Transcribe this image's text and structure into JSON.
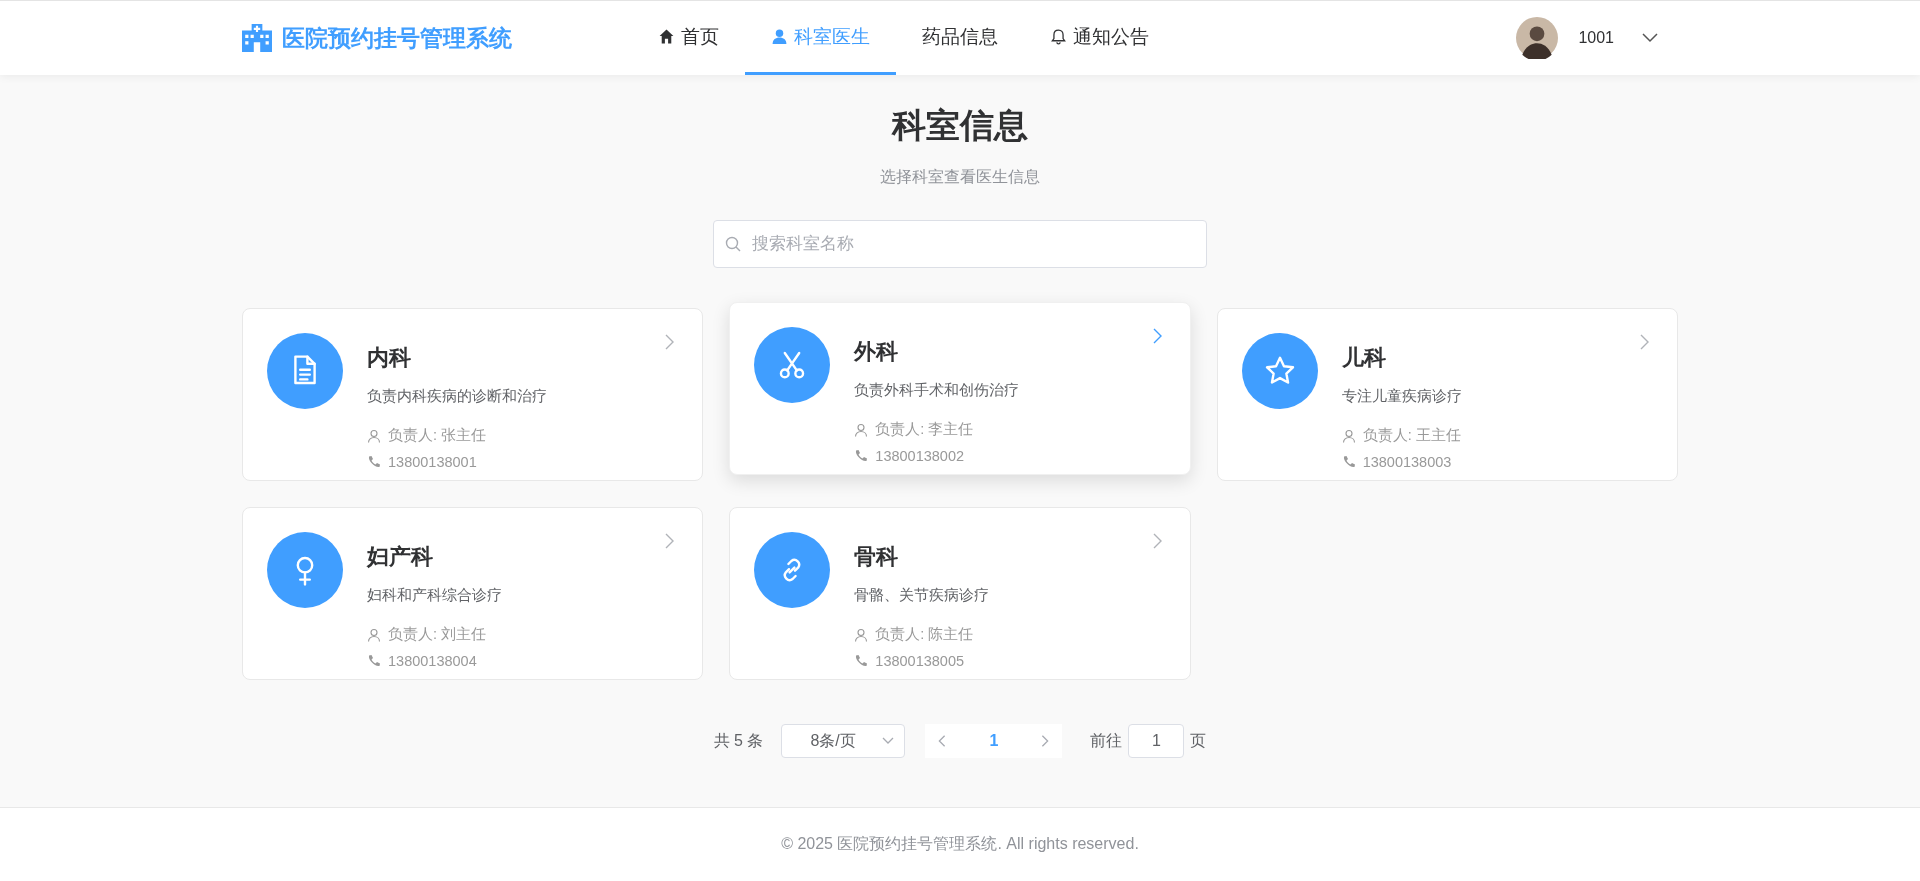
{
  "header": {
    "brand": "医院预约挂号管理系统",
    "nav": [
      {
        "label": "首页",
        "selected": false
      },
      {
        "label": "科室医生",
        "selected": true
      },
      {
        "label": "药品信息",
        "selected": false
      },
      {
        "label": "通知公告",
        "selected": false
      }
    ],
    "user": {
      "name": "1001"
    }
  },
  "page": {
    "title": "科室信息",
    "subtitle": "选择科室查看医生信息"
  },
  "search": {
    "placeholder": "搜索科室名称"
  },
  "departments": [
    {
      "name": "内科",
      "description": "负责内科疾病的诊断和治疗",
      "head": "负责人: 张主任",
      "phone": "13800138001",
      "hovered": false
    },
    {
      "name": "外科",
      "description": "负责外科手术和创伤治疗",
      "head": "负责人: 李主任",
      "phone": "13800138002",
      "hovered": true
    },
    {
      "name": "儿科",
      "description": "专注儿童疾病诊疗",
      "head": "负责人: 王主任",
      "phone": "13800138003",
      "hovered": false
    },
    {
      "name": "妇产科",
      "description": "妇科和产科综合诊疗",
      "head": "负责人: 刘主任",
      "phone": "13800138004",
      "hovered": false
    },
    {
      "name": "骨科",
      "description": "骨骼、关节疾病诊疗",
      "head": "负责人: 陈主任",
      "phone": "13800138005",
      "hovered": false
    }
  ],
  "pagination": {
    "total": "共 5 条",
    "page_size": "8条/页",
    "pages": [
      {
        "label": "1",
        "selected": true
      }
    ],
    "goto_label": "前往",
    "goto_value": "1",
    "goto_suffix": "页"
  },
  "footer": {
    "text": "© 2025 医院预约挂号管理系统. All rights reserved."
  }
}
